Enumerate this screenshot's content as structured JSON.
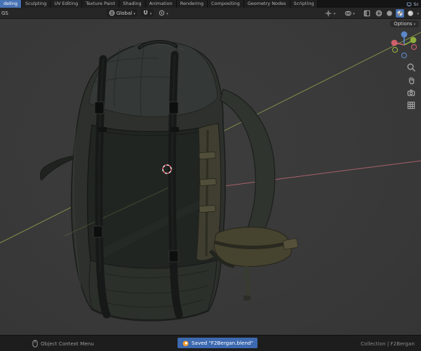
{
  "topbar": {
    "tabs": [
      {
        "label": "deling",
        "active": true
      },
      {
        "label": "Sculpting",
        "active": false
      },
      {
        "label": "UV Editing",
        "active": false
      },
      {
        "label": "Texture Paint",
        "active": false
      },
      {
        "label": "Shading",
        "active": false
      },
      {
        "label": "Animation",
        "active": false
      },
      {
        "label": "Rendering",
        "active": false
      },
      {
        "label": "Compositing",
        "active": false
      },
      {
        "label": "Geometry Nodes",
        "active": false
      },
      {
        "label": "Scripting",
        "active": false
      }
    ],
    "scene_label": "Sc"
  },
  "header": {
    "left_fragment": "GS",
    "orientation_label": "Global",
    "options_label": "Options"
  },
  "viewport": {
    "background": "#3a3a3a",
    "axis_colors": {
      "x": "#a8616c",
      "y": "#87954c"
    },
    "model": "military-backpack",
    "shading_mode_active": "material-preview"
  },
  "icons": {
    "orientation": "globe-icon",
    "snap": "magnet-icon",
    "proportional": "circle-dot-icon",
    "gizmo": "gizmo-icon",
    "overlays": "overlays-icon",
    "xray": "xray-icon",
    "shading_wireframe": "wireframe-sphere-icon",
    "shading_solid": "solid-sphere-icon",
    "shading_material": "material-sphere-icon",
    "shading_rendered": "rendered-sphere-icon",
    "zoom": "magnifier-icon",
    "pan": "hand-icon",
    "camera": "camera-icon",
    "ortho": "grid-icon",
    "context": "mouse-icon",
    "app": "blender-logo-icon"
  },
  "status_bar": {
    "left_hint": "Object Context Menu",
    "notification": "Saved \"F2Bergan.blend\"",
    "right_info": "Collection | F2Bergan"
  },
  "colors": {
    "accent": "#4772b3",
    "notification_bg": "#3c69b0",
    "axis_x": "#a8616c",
    "axis_y": "#87954c"
  }
}
